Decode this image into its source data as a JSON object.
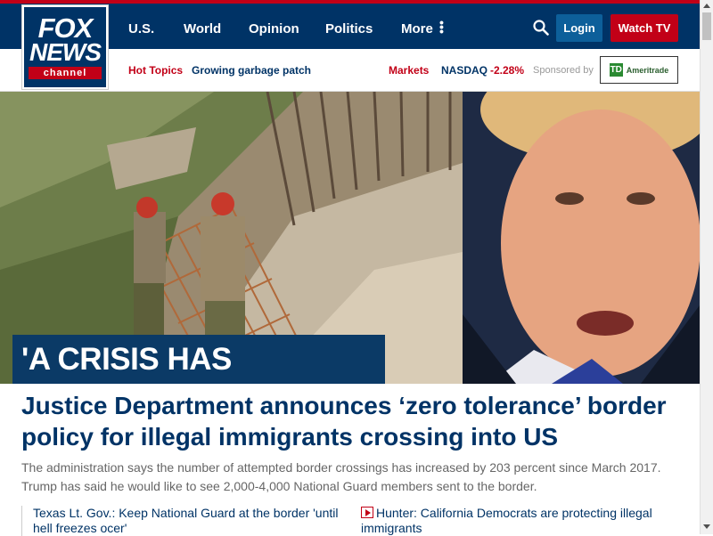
{
  "logo": {
    "line1": "FOX",
    "line2": "NEWS",
    "line3": "channel"
  },
  "nav": [
    {
      "label": "U.S."
    },
    {
      "label": "World"
    },
    {
      "label": "Opinion"
    },
    {
      "label": "Politics"
    },
    {
      "label": "More"
    }
  ],
  "header": {
    "login_label": "Login",
    "watch_label": "Watch TV"
  },
  "subnav": {
    "hot_topics": "Hot Topics",
    "topic": "Growing garbage patch",
    "markets": "Markets",
    "nasdaq_label": "NASDAQ",
    "nasdaq_value": "-2.28%",
    "sponsored": "Sponsored by",
    "sponsor_mark": "TD",
    "sponsor_name": "Ameritrade"
  },
  "hero": {
    "banner": "'A CRISIS HAS ERUPTED'"
  },
  "article": {
    "headline": "Justice Department announces ‘zero tolerance’ border policy for illegal immigrants crossing into US",
    "summary": "The administration says the number of attempted border crossings has increased by 203 percent since March 2017. Trump has said he would like to see 2,000-4,000 National Guard members sent to the border."
  },
  "related": [
    {
      "text": "Texas Lt. Gov.: Keep National Guard at the border 'until hell freezes ocer'"
    },
    {
      "text": "Hunter: California Democrats are protecting illegal immigrants"
    }
  ],
  "colors": {
    "brand_navy": "#003366",
    "brand_red": "#c20017",
    "login_blue": "#0d5f9a",
    "sponsor_green": "#2a8a32"
  },
  "icons": {
    "search": "search-icon",
    "more": "more-vertical-dots-icon",
    "video": "play-icon"
  }
}
